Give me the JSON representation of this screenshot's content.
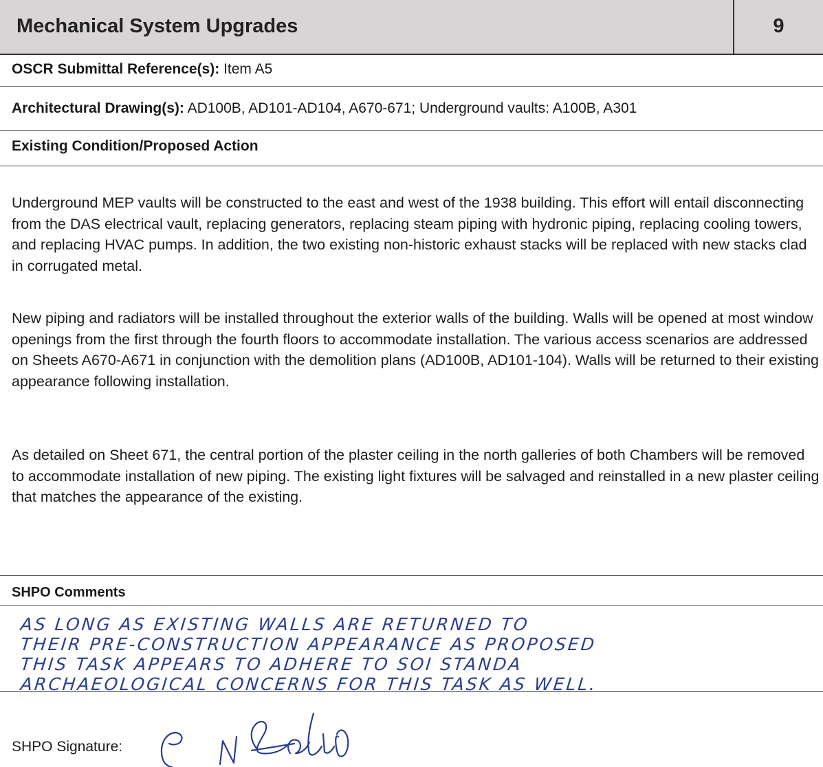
{
  "header": {
    "title": "Mechanical System Upgrades",
    "number": "9"
  },
  "oscr": {
    "label": "OSCR Submittal Reference(s):",
    "value": "Item A5"
  },
  "drawings": {
    "label": "Architectural Drawing(s):",
    "value": "AD100B, AD101-AD104, A670-671; Underground vaults: A100B, A301"
  },
  "existing_condition": {
    "label": "Existing Condition/Proposed Action",
    "paragraphs": [
      "Underground MEP vaults will be constructed to the east and west of the 1938 building. This effort will entail disconnecting from the DAS electrical vault, replacing generators, replacing steam piping with hydronic piping, replacing cooling towers, and replacing HVAC pumps. In addition, the two existing non-historic exhaust stacks will be replaced with new stacks clad in corrugated metal.",
      "New piping and radiators will be installed throughout the exterior walls of the building. Walls will be opened at most window openings from the first through the fourth floors to accommodate installation. The various access scenarios are addressed on Sheets A670-A671 in conjunction with the demolition plans (AD100B, AD101-104). Walls will be returned to their existing appearance following installation.",
      "As detailed on Sheet 671, the central portion of the plaster ceiling in the north galleries of both Chambers will be removed to accommodate installation of new piping. The existing light fixtures will be salvaged and reinstalled in a new plaster ceiling that matches the appearance of the existing."
    ]
  },
  "shpo_comments": {
    "label": "SHPO Comments",
    "handwritten_lines": [
      "AS  LONG  AS  EXISTING  WALLS  ARE  RETURNED  TO",
      "THEIR  PRE-CONSTRUCTION  APPEARANCE  AS PROPOSED",
      "THIS  TASK  APPEARS  TO  ADHERE  TO  SOI  STANDA",
      "ARCHAEOLOGICAL  CONCERNS  FOR  THIS  TASK  AS WELL."
    ]
  },
  "shpo_signature": {
    "label": "SHPO Signature:",
    "ink_color": "#2a3f8f"
  },
  "colors": {
    "header_bg": "#d9d4d6",
    "handwriting": "#2a3f8f"
  }
}
